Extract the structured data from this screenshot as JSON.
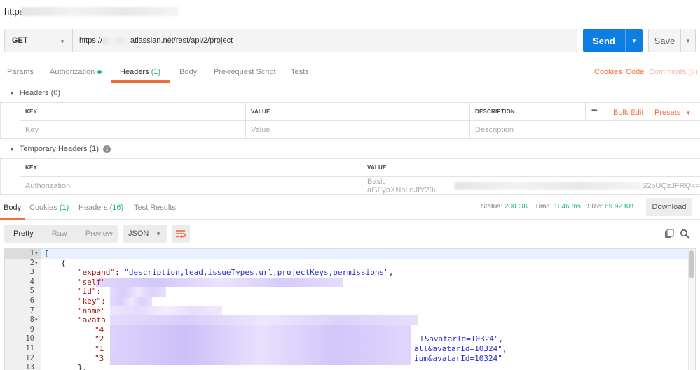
{
  "title": "https",
  "request": {
    "method": "GET",
    "url_prefix": "https://",
    "url_suffix": "atlassian.net/rest/api/2/project",
    "send_label": "Send",
    "save_label": "Save"
  },
  "req_tabs": {
    "params": "Params",
    "authorization": "Authorization",
    "headers": "Headers",
    "headers_count": "(1)",
    "body": "Body",
    "prerequest": "Pre-request Script",
    "tests": "Tests",
    "cookies": "Cookies",
    "code": "Code",
    "comments": "Comments (0)"
  },
  "headers_section": {
    "title": "Headers",
    "count": "(0)",
    "col_key": "KEY",
    "col_value": "VALUE",
    "col_description": "DESCRIPTION",
    "more": "•••",
    "bulk_edit": "Bulk Edit",
    "presets": "Presets",
    "placeholder_key": "Key",
    "placeholder_value": "Value",
    "placeholder_description": "Description"
  },
  "temp_headers": {
    "title": "Temporary Headers",
    "count": "(1)",
    "col_key": "KEY",
    "col_value": "VALUE",
    "row_key": "Authorization",
    "row_value_start": "Basic aGFyaXNoLnJfY29u",
    "row_value_end": "S2pUQzJFRQ=="
  },
  "response": {
    "tabs": {
      "body": "Body",
      "cookies": "Cookies",
      "cookies_count": "(1)",
      "headers": "Headers",
      "headers_count": "(16)",
      "test_results": "Test Results"
    },
    "status_label": "Status:",
    "status_value": "200 OK",
    "time_label": "Time:",
    "time_value": "1046 ms",
    "size_label": "Size:",
    "size_value": "69.92 KB",
    "download_label": "Download",
    "view_pretty": "Pretty",
    "view_raw": "Raw",
    "view_preview": "Preview",
    "format": "JSON"
  },
  "code": {
    "line_numbers": [
      "1",
      "2",
      "3",
      "4",
      "5",
      "6",
      "7",
      "8",
      "9",
      "10",
      "11",
      "12",
      "13"
    ],
    "l1": "[",
    "l2": "{",
    "l3_key": "\"expand\"",
    "l3_val": "\"description,lead,issueTypes,url,projectKeys,permissions\"",
    "l4_key": "\"self\"",
    "l5_key": "\"id\":",
    "l6_key": "\"key\":",
    "l7_key": "\"name\"",
    "l8_key": "\"avata",
    "l9_key": "\"4",
    "l10_key": "\"2",
    "l10_tail": "l&avatarId=10324\",",
    "l11_key": "\"1",
    "l11_tail": "all&avatarId=10324\",",
    "l12_key": "\"3",
    "l12_tail": "ium&avatarId=10324\"",
    "l13": "},"
  },
  "colors": {
    "accent": "#f26b3a",
    "send": "#0f7ee3",
    "status_green": "#26b47f"
  }
}
